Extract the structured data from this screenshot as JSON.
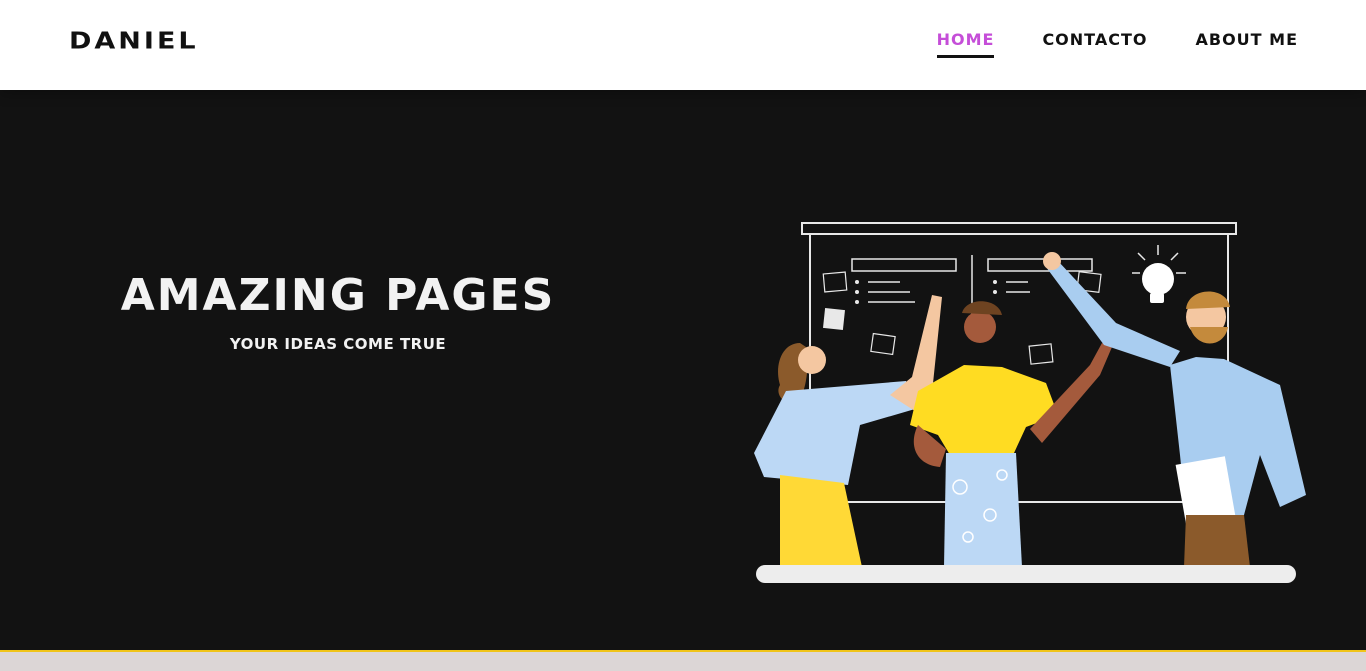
{
  "brand": {
    "logo": "DANIEL"
  },
  "nav": {
    "items": [
      {
        "label": "HOME",
        "active": true
      },
      {
        "label": "CONTACTO",
        "active": false
      },
      {
        "label": "ABOUT ME",
        "active": false
      }
    ]
  },
  "hero": {
    "title": "AMAZING PAGES",
    "subtitle": "YOUR IDEAS COME TRUE"
  },
  "colors": {
    "accent": "#c54ed8",
    "background": "#121212",
    "navbar": "#ffffff",
    "footer_strip": "#dcd6d6",
    "footer_border": "#f0c419"
  }
}
